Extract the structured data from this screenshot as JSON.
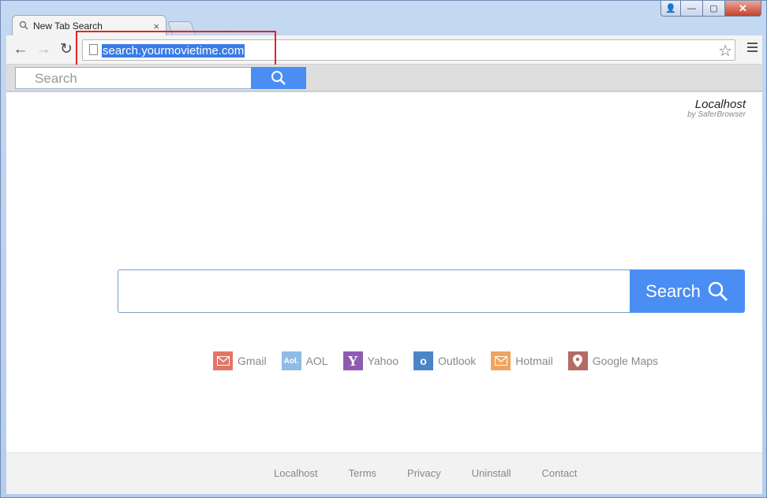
{
  "window": {
    "controls": {
      "user": "👤",
      "minimize": "—",
      "maximize": "▢",
      "close": "✕"
    }
  },
  "tab": {
    "title": "New Tab Search",
    "close": "×",
    "icon": "search-icon"
  },
  "toolbar": {
    "back": "←",
    "forward": "→",
    "reload": "↻",
    "url": "search.yourmovietime.com",
    "star": "☆"
  },
  "ext_bar": {
    "placeholder": "Search"
  },
  "brand": {
    "name": "Localhost",
    "sub": "by SaferBrowser"
  },
  "main_search": {
    "button_label": "Search"
  },
  "quick_links": [
    {
      "label": "Gmail",
      "icon_text": "",
      "color": "#e57468"
    },
    {
      "label": "AOL",
      "icon_text": "Aol.",
      "color": "#8fbce4"
    },
    {
      "label": "Yahoo",
      "icon_text": "Y",
      "color": "#8e5bb2"
    },
    {
      "label": "Outlook",
      "icon_text": "o",
      "color": "#4a86c6"
    },
    {
      "label": "Hotmail",
      "icon_text": "",
      "color": "#f2a45c"
    },
    {
      "label": "Google Maps",
      "icon_text": "",
      "color": "#b56b63"
    }
  ],
  "footer": {
    "links": [
      "Localhost",
      "Terms",
      "Privacy",
      "Uninstall",
      "Contact"
    ]
  },
  "colors": {
    "accent": "#4a8ef3",
    "highlight": "#e02525",
    "url_selection": "#3a7be6"
  }
}
